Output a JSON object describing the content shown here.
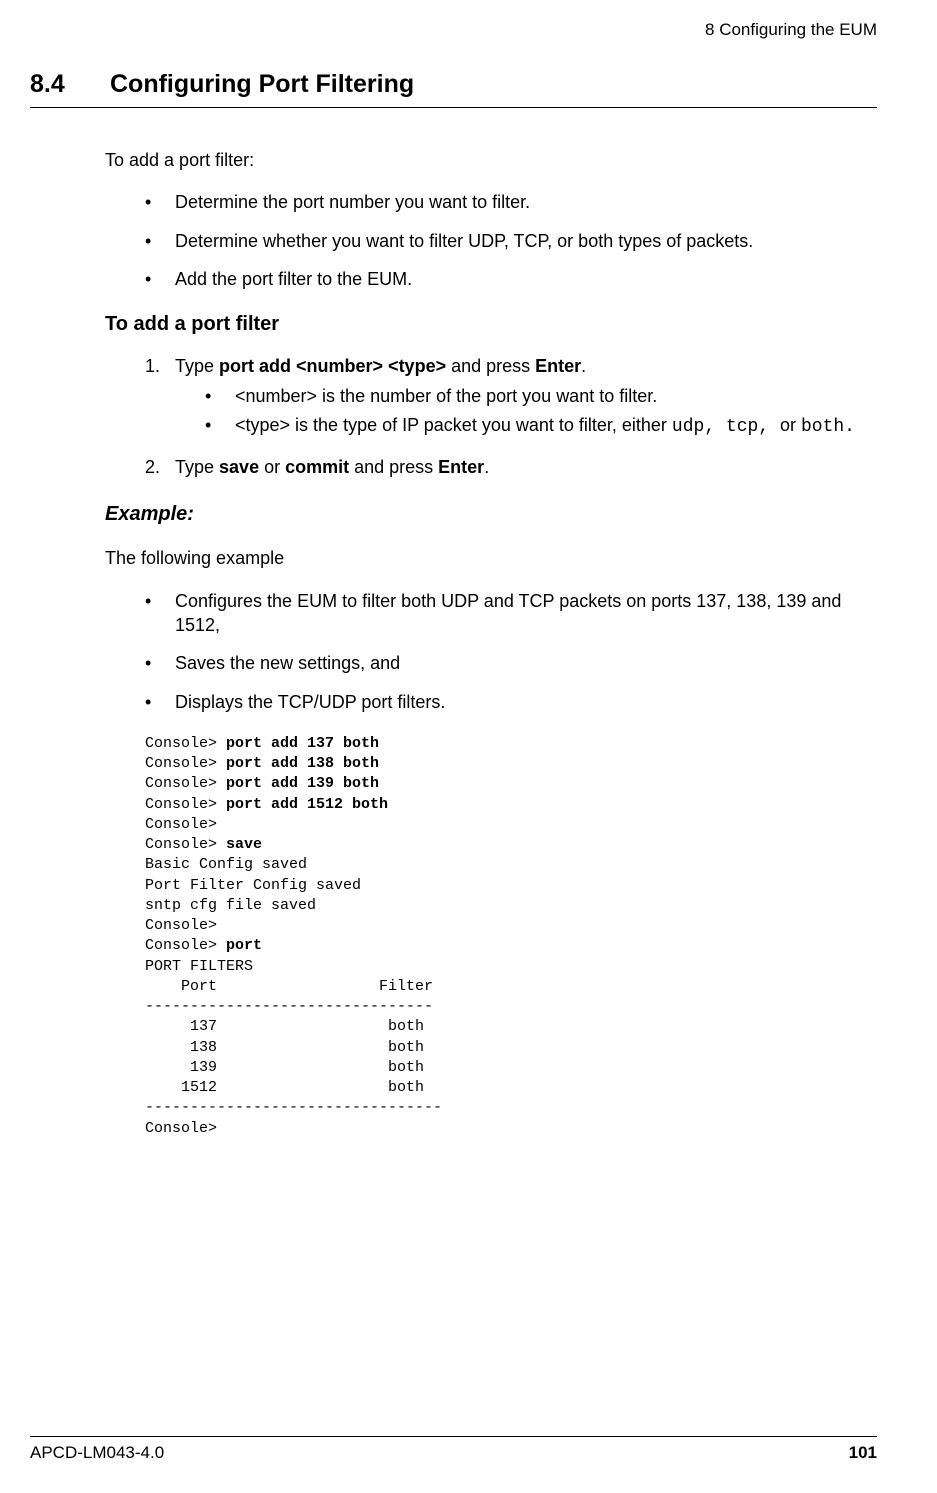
{
  "header": {
    "right": "8  Configuring the EUM"
  },
  "section": {
    "num": "8.4",
    "title": "Configuring Port Filtering"
  },
  "intro": "To add a port filter:",
  "intro_bullets": [
    "Determine the port number you want to filter.",
    "Determine whether you want to filter UDP, TCP, or both types of packets.",
    "Add the port filter to the EUM."
  ],
  "subheading": "To add a port filter",
  "steps": [
    {
      "num": "1.",
      "p1": "Type ",
      "b1": "port add <number> <type>",
      "p2": " and press ",
      "b2": "Enter",
      "p3": ".",
      "sub": [
        {
          "t1": "<number> is the number of the port you want to filter."
        },
        {
          "t1": "<type> is the type of IP packet you want to filter, either ",
          "m1": "udp, tcp, ",
          "t2": "or ",
          "m2": "both."
        }
      ]
    },
    {
      "num": "2.",
      "p1": "Type ",
      "b1": "save",
      "p2": " or ",
      "b2": "commit",
      "p3": " and press ",
      "b3": "Enter",
      "p4": "."
    }
  ],
  "example_head": "Example:",
  "example_intro": "The following example",
  "example_bullets": [
    "Configures the EUM to filter both UDP and TCP packets on ports 137, 138, 139 and 1512,",
    "Saves the new settings, and",
    "Displays the TCP/UDP port filters."
  ],
  "console": [
    {
      "p": "Console> ",
      "b": "port add 137 both"
    },
    {
      "p": "Console> ",
      "b": "port add 138 both"
    },
    {
      "p": "Console> ",
      "b": "port add 139 both"
    },
    {
      "p": "Console> ",
      "b": "port add 1512 both"
    },
    {
      "p": "Console>"
    },
    {
      "p": "Console> ",
      "b": "save"
    },
    {
      "p": "Basic Config saved"
    },
    {
      "p": "Port Filter Config saved"
    },
    {
      "p": "sntp cfg file saved"
    },
    {
      "p": "Console>"
    },
    {
      "p": "Console> ",
      "b": "port"
    },
    {
      "p": "PORT FILTERS"
    },
    {
      "p": "    Port                  Filter"
    },
    {
      "p": "--------------------------------"
    },
    {
      "p": "     137                   both"
    },
    {
      "p": "     138                   both"
    },
    {
      "p": "     139                   both"
    },
    {
      "p": "    1512                   both"
    },
    {
      "p": "---------------------------------"
    },
    {
      "p": "Console>"
    }
  ],
  "footer": {
    "left": "APCD-LM043-4.0",
    "right": "101"
  }
}
